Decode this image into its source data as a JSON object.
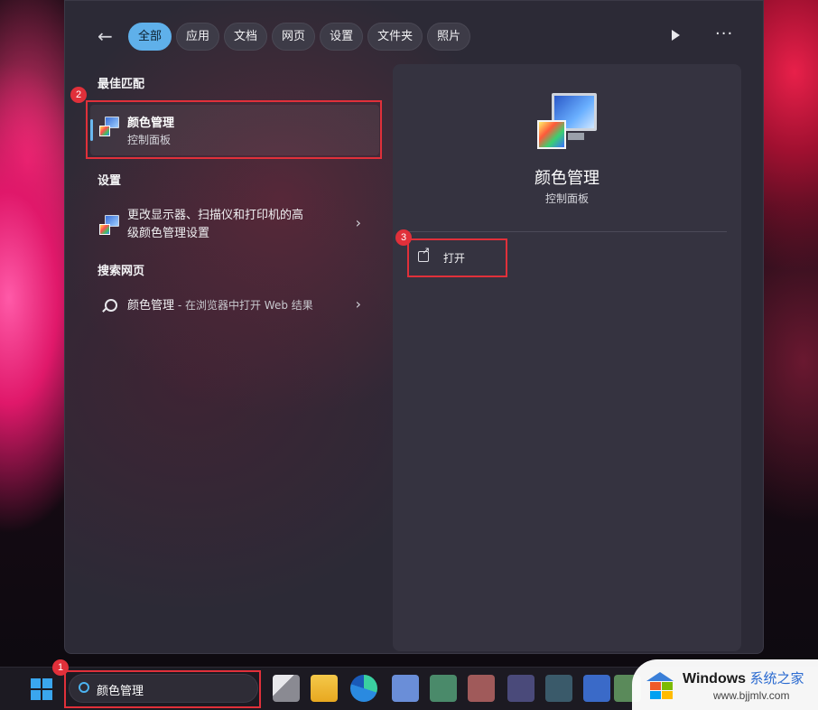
{
  "filters": [
    {
      "label": "全部",
      "active": true
    },
    {
      "label": "应用",
      "active": false
    },
    {
      "label": "文档",
      "active": false
    },
    {
      "label": "网页",
      "active": false
    },
    {
      "label": "设置",
      "active": false
    },
    {
      "label": "文件夹",
      "active": false
    },
    {
      "label": "照片",
      "active": false
    }
  ],
  "sections": {
    "best_match": "最佳匹配",
    "settings": "设置",
    "web": "搜索网页"
  },
  "best_match": {
    "title": "颜色管理",
    "subtitle": "控制面板"
  },
  "settings_item": {
    "line1": "更改显示器、扫描仪和打印机的高",
    "line2": "级颜色管理设置"
  },
  "web_item": {
    "query": "颜色管理",
    "suffix": " - 在浏览器中打开 Web 结果"
  },
  "preview": {
    "title": "颜色管理",
    "subtitle": "控制面板",
    "action_open": "打开"
  },
  "taskbar": {
    "search_value": "颜色管理"
  },
  "callouts": [
    "1",
    "2",
    "3"
  ],
  "watermark": {
    "brand": "Windows",
    "brand_cn": "系统之家",
    "url": "www.bjjmlv.com"
  },
  "colors": {
    "accent": "#5fb0ea",
    "callout": "#e0303a"
  }
}
